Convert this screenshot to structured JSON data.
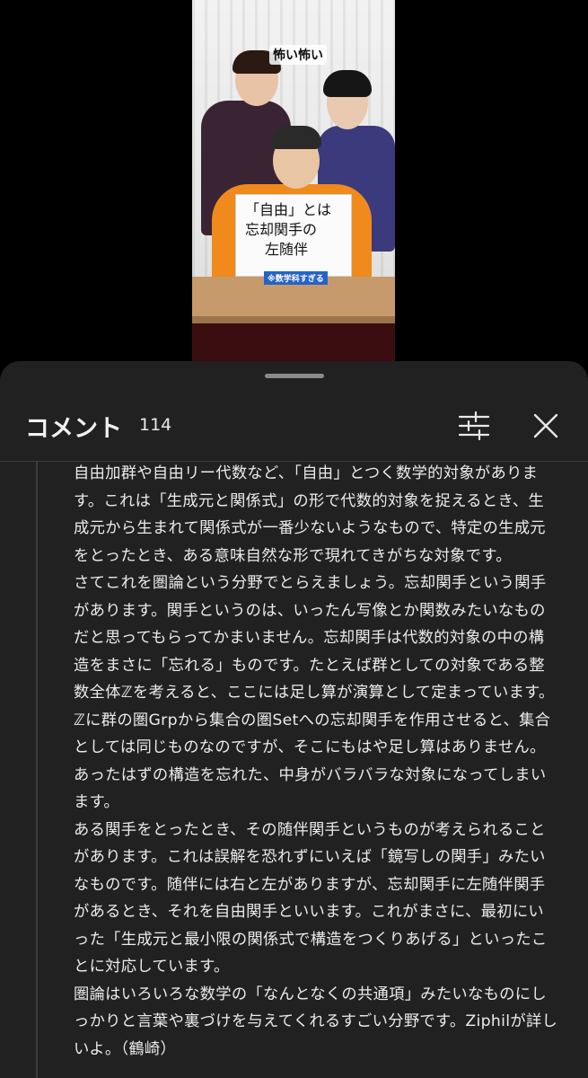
{
  "video": {
    "caption": "怖い怖い",
    "board_lines": [
      "「自由」とは",
      "忘却関手の",
      "左随伴"
    ],
    "board_note": "※数学科すぎる"
  },
  "comments": {
    "title": "コメント",
    "count": "114",
    "icons": {
      "filter": "sliders-icon",
      "close": "close-icon"
    },
    "body": [
      "自由加群や自由リー代数など、「自由」とつく数学的対象があります。これは「生成元と関係式」の形で代数的対象を捉えるとき、生成元から生まれて関係式が一番少ないようなもので、特定の生成元をとったとき、ある意味自然な形で現れてきがちな対象です。",
      "さてこれを圏論という分野でとらえましょう。忘却関手という関手があります。関手というのは、いったん写像とか関数みたいなものだと思ってもらってかまいません。忘却関手は代数的対象の中の構造をまさに「忘れる」ものです。たとえば群としての対象である整数全体ℤを考えると、ここには足し算が演算として定まっています。ℤに群の圏Grpから集合の圏Setへの忘却関手を作用させると、集合としては同じものなのですが、そこにもはや足し算はありません。あったはずの構造を忘れた、中身がバラバラな対象になってしまいます。",
      "ある関手をとったとき、その随伴関手というものが考えられることがあります。これは誤解を恐れずにいえば「鏡写しの関手」みたいなものです。随伴には右と左がありますが、忘却関手に左随伴関手があるとき、それを自由関手といいます。これがまさに、最初にいった「生成元と最小限の関係式で構造をつくりあげる」といったことに対応しています。",
      "圏論はいろいろな数学の「なんとなくの共通項」みたいなものにしっかりと言葉や裏づけを与えてくれるすごい分野です。Ziphilが詳しいよ。（鶴崎）"
    ]
  }
}
